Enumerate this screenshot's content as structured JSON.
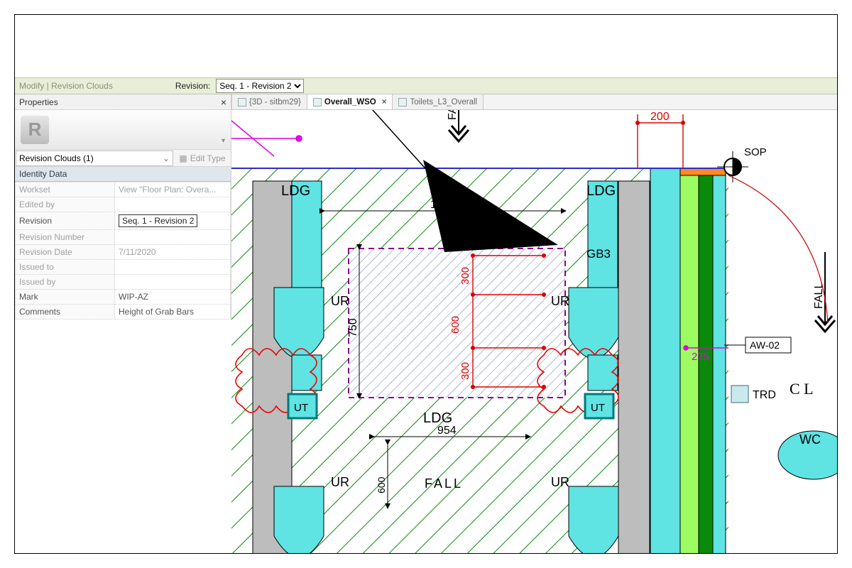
{
  "ribbon": {
    "context": "Modify | Revision Clouds",
    "revision_label": "Revision:",
    "revision_value": "Seq. 1 - Revision 2"
  },
  "properties": {
    "title": "Properties",
    "selector": "Revision Clouds (1)",
    "edit_type": "Edit Type",
    "category": "Identity Data",
    "rows": [
      {
        "k": "Workset",
        "v": "View \"Floor Plan: Overa...",
        "dim": true
      },
      {
        "k": "Edited by",
        "v": "",
        "dim": true
      },
      {
        "k": "Revision",
        "v": "Seq. 1 - Revision 2",
        "boxed": true
      },
      {
        "k": "Revision Number",
        "v": "",
        "dim": true
      },
      {
        "k": "Revision Date",
        "v": "7/11/2020",
        "dim": true
      },
      {
        "k": "Issued to",
        "v": "",
        "dim": true
      },
      {
        "k": "Issued by",
        "v": "",
        "dim": true
      },
      {
        "k": "Mark",
        "v": "WIP-AZ"
      },
      {
        "k": "Comments",
        "v": "Height of Grab Bars"
      }
    ]
  },
  "tabs": [
    {
      "label": "{3D - sitbm29}",
      "active": false,
      "closeable": false
    },
    {
      "label": "Overall_WSO",
      "active": true,
      "closeable": true
    },
    {
      "label": "Toilets_L3_Overall",
      "active": false,
      "closeable": false
    }
  ],
  "drawing": {
    "labels": {
      "LDG": "LDG",
      "UR": "UR",
      "UT": "UT",
      "GB3": "GB3",
      "SOP": "SOP",
      "TRD": "TRD",
      "WC": "WC",
      "AW02": "AW-02",
      "FALL": "FALL",
      "CL": "C L"
    },
    "dims": {
      "d1200": "1200",
      "d750": "750",
      "d954": "954",
      "d600v": "600",
      "d600h": "600",
      "d300a": "300",
      "d300b": "300",
      "d200": "200",
      "d275": "275"
    }
  }
}
